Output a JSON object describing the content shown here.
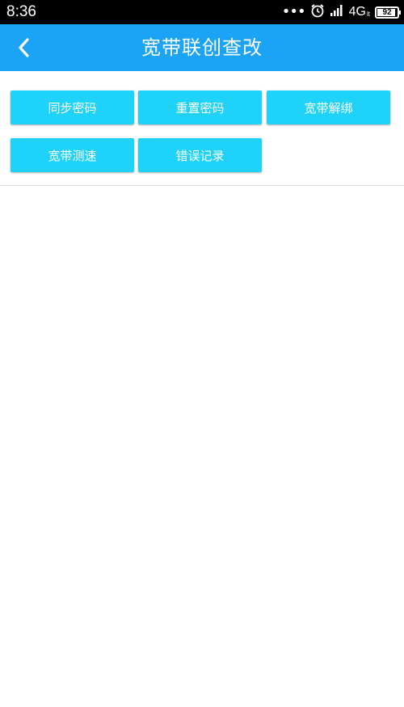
{
  "status_bar": {
    "time": "8:36",
    "network": "4G",
    "network_sub": "lt",
    "battery_level": 92,
    "battery_text": "92",
    "icons": [
      "more-dots-icon",
      "alarm-icon",
      "signal-icon",
      "battery-icon"
    ]
  },
  "header": {
    "title": "宽带联创查改",
    "back_icon": "chevron-left-icon",
    "background_color": "#1ba3f5"
  },
  "actions": {
    "button_color": "#1ed2fa",
    "items": [
      {
        "label": "同步密码"
      },
      {
        "label": "重置密码"
      },
      {
        "label": "宽带解绑"
      },
      {
        "label": "宽带测速"
      },
      {
        "label": "错误记录"
      }
    ]
  }
}
